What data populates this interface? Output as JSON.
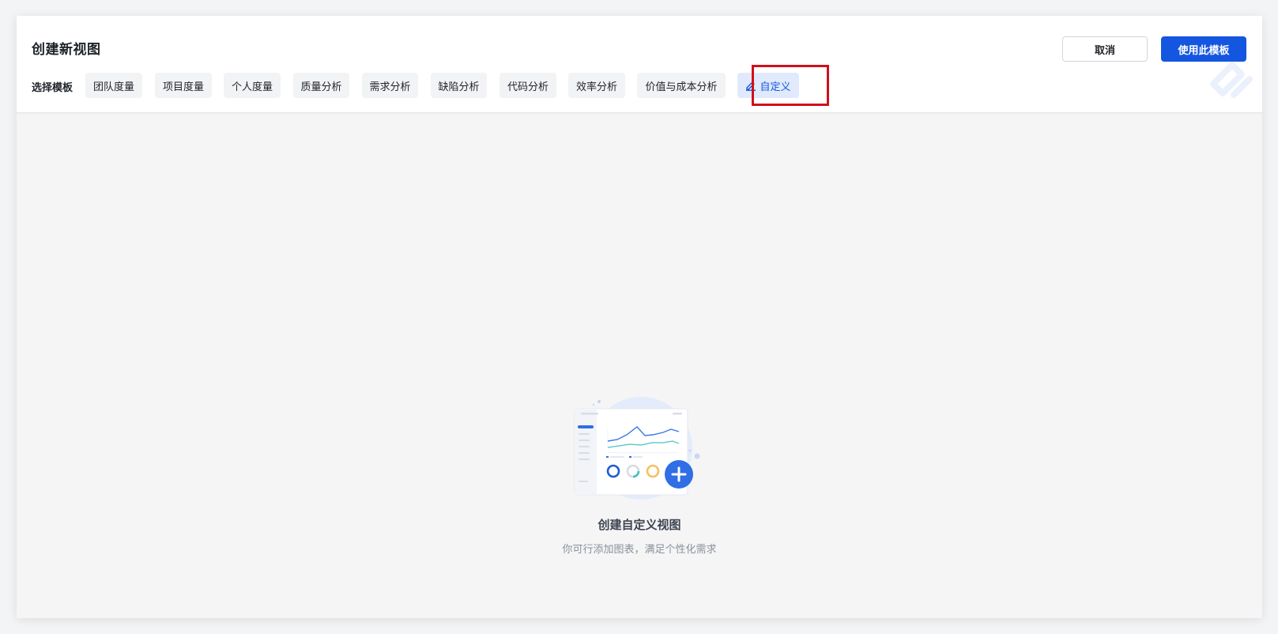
{
  "header": {
    "title": "创建新视图",
    "cancel_label": "取消",
    "use_label": "使用此模板"
  },
  "templates": {
    "label": "选择模板",
    "tabs": [
      {
        "label": "团队度量"
      },
      {
        "label": "项目度量"
      },
      {
        "label": "个人度量"
      },
      {
        "label": "质量分析"
      },
      {
        "label": "需求分析"
      },
      {
        "label": "缺陷分析"
      },
      {
        "label": "代码分析"
      },
      {
        "label": "效率分析"
      },
      {
        "label": "价值与成本分析"
      },
      {
        "label": "自定义",
        "icon": "pencil-icon",
        "active": true
      }
    ]
  },
  "empty_state": {
    "title": "创建自定义视图",
    "description": "你可行添加图表，满足个性化需求"
  },
  "colors": {
    "accent": "#1456e0",
    "highlight": "#d0101b",
    "tab_bg": "#f2f3f5",
    "active_tab_bg": "#e1eafc"
  }
}
